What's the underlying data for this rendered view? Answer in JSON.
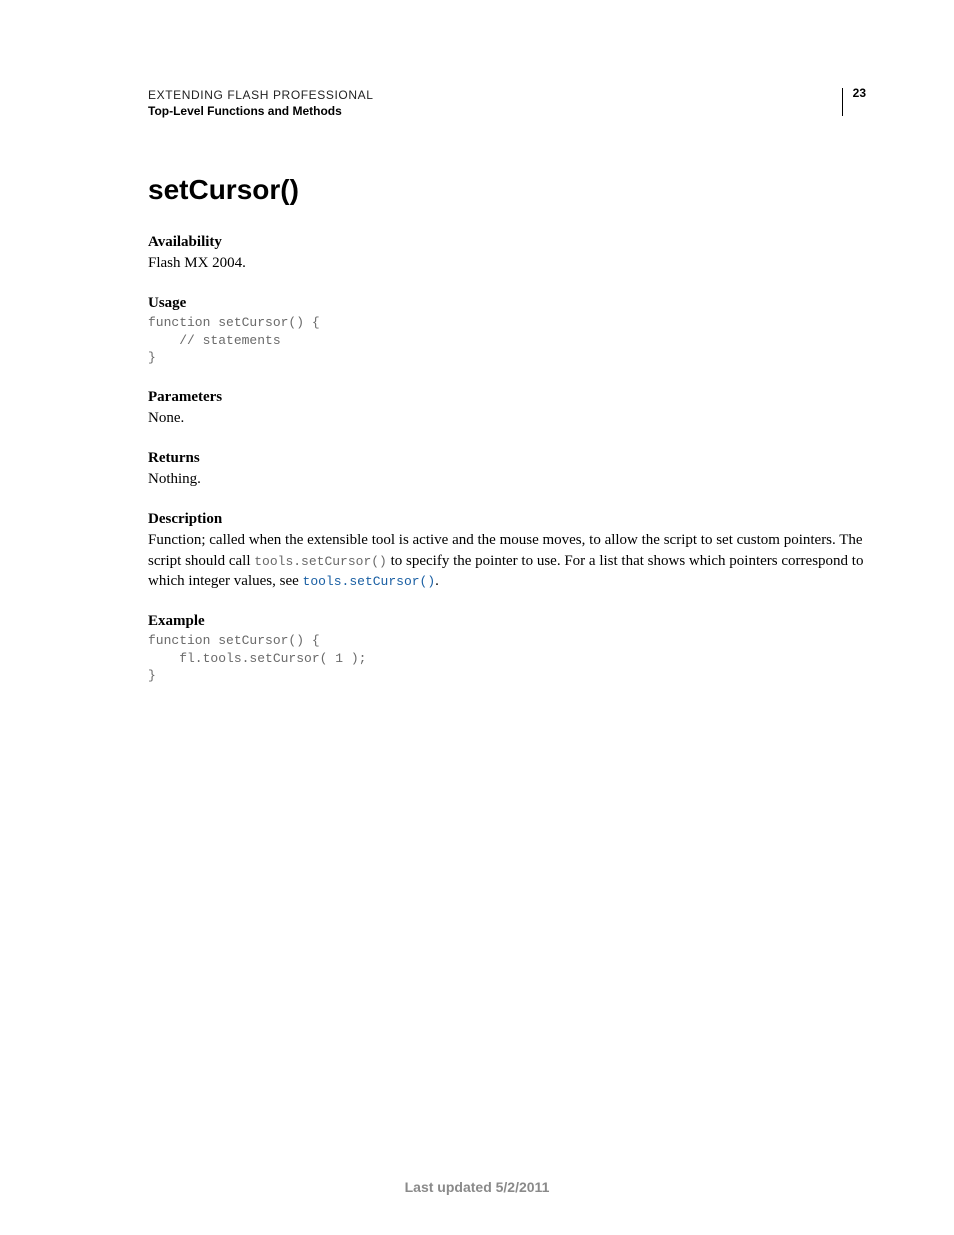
{
  "header": {
    "doc_title": "EXTENDING FLASH PROFESSIONAL",
    "doc_subtitle": "Top-Level Functions and Methods",
    "page_number": "23"
  },
  "title": "setCursor()",
  "sections": {
    "availability": {
      "label": "Availability",
      "text": "Flash MX 2004."
    },
    "usage": {
      "label": "Usage",
      "code": "function setCursor() {\n    // statements\n}"
    },
    "parameters": {
      "label": "Parameters",
      "text": "None."
    },
    "returns": {
      "label": "Returns",
      "text": "Nothing."
    },
    "description": {
      "label": "Description",
      "text_1": "Function; called when the extensible tool is active and the mouse moves, to allow the script to set custom pointers. The script should call ",
      "code_inline": "tools.setCursor()",
      "text_2": " to specify the pointer to use. For a list that shows which pointers correspond to which integer values, see ",
      "link_text": "tools.setCursor()",
      "text_3": "."
    },
    "example": {
      "label": "Example",
      "code": "function setCursor() {\n    fl.tools.setCursor( 1 );\n}"
    }
  },
  "footer": "Last updated 5/2/2011"
}
